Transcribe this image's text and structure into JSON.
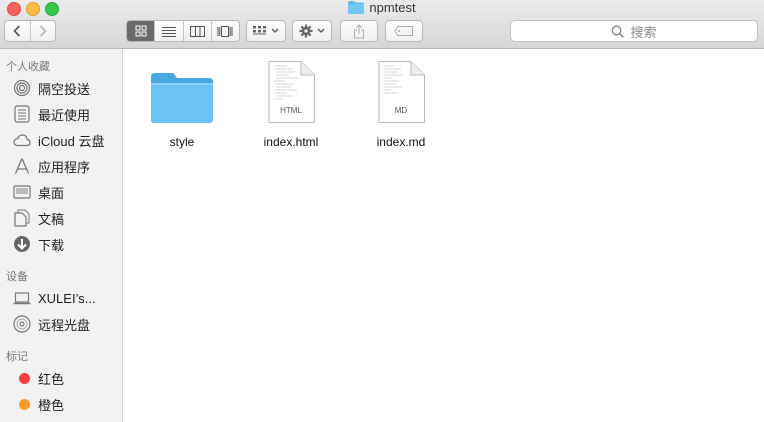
{
  "window": {
    "title": "npmtest"
  },
  "toolbar": {
    "back_label": "back",
    "forward_label": "forward",
    "search_placeholder": "搜索"
  },
  "sidebar": {
    "favorites_header": "个人收藏",
    "favorites": [
      {
        "label": "隔空投送",
        "icon": "airdrop-icon"
      },
      {
        "label": "最近使用",
        "icon": "recents-icon"
      },
      {
        "label": "iCloud 云盘",
        "icon": "icloud-icon"
      },
      {
        "label": "应用程序",
        "icon": "applications-icon"
      },
      {
        "label": "桌面",
        "icon": "desktop-icon"
      },
      {
        "label": "文稿",
        "icon": "documents-icon"
      },
      {
        "label": "下载",
        "icon": "downloads-icon"
      }
    ],
    "devices_header": "设备",
    "devices": [
      {
        "label": "XULEI’s...",
        "icon": "laptop-icon"
      },
      {
        "label": "远程光盘",
        "icon": "disc-icon"
      }
    ],
    "tags_header": "标记",
    "tags": [
      {
        "label": "红色",
        "color": "#fc3d39"
      },
      {
        "label": "橙色",
        "color": "#fd9a28"
      }
    ]
  },
  "files": [
    {
      "name": "style",
      "kind": "folder"
    },
    {
      "name": "index.html",
      "kind": "document",
      "badge": "HTML"
    },
    {
      "name": "index.md",
      "kind": "document",
      "badge": "MD"
    }
  ]
}
